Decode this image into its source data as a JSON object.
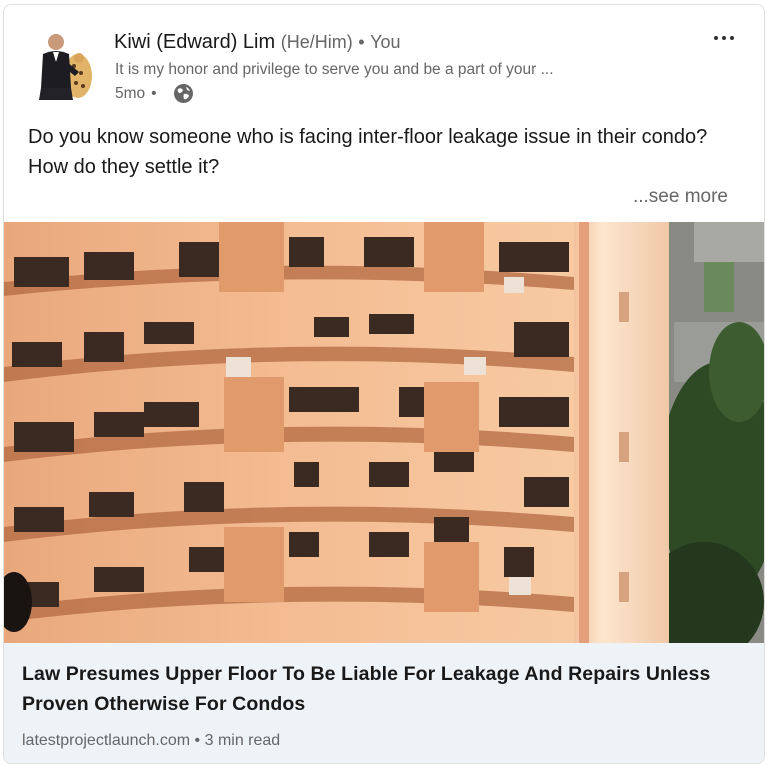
{
  "post": {
    "author_name": "Kiwi (Edward) Lim",
    "pronouns": "(He/Him)",
    "separator": "•",
    "relationship": "You",
    "headline": "It is my honor and privilege to serve you and be a part of your ...",
    "time_ago": "5mo",
    "time_separator": "•",
    "visibility_icon": "globe-icon",
    "more_icon": "more-options-icon",
    "text": "Do you know someone who is facing inter-floor leakage issue in their condo? How do they settle it?",
    "see_more": "...see more"
  },
  "article": {
    "title": "Law Presumes Upper Floor To Be Liable For Leakage And Repairs Unless Proven Otherwise For Condos",
    "source": "latestprojectlaunch.com",
    "meta_separator": "•",
    "read_time": "3 min read"
  },
  "colors": {
    "building": "#f2b48a",
    "building_shadow": "#b8673d",
    "footer_bg": "#eef3f8"
  }
}
